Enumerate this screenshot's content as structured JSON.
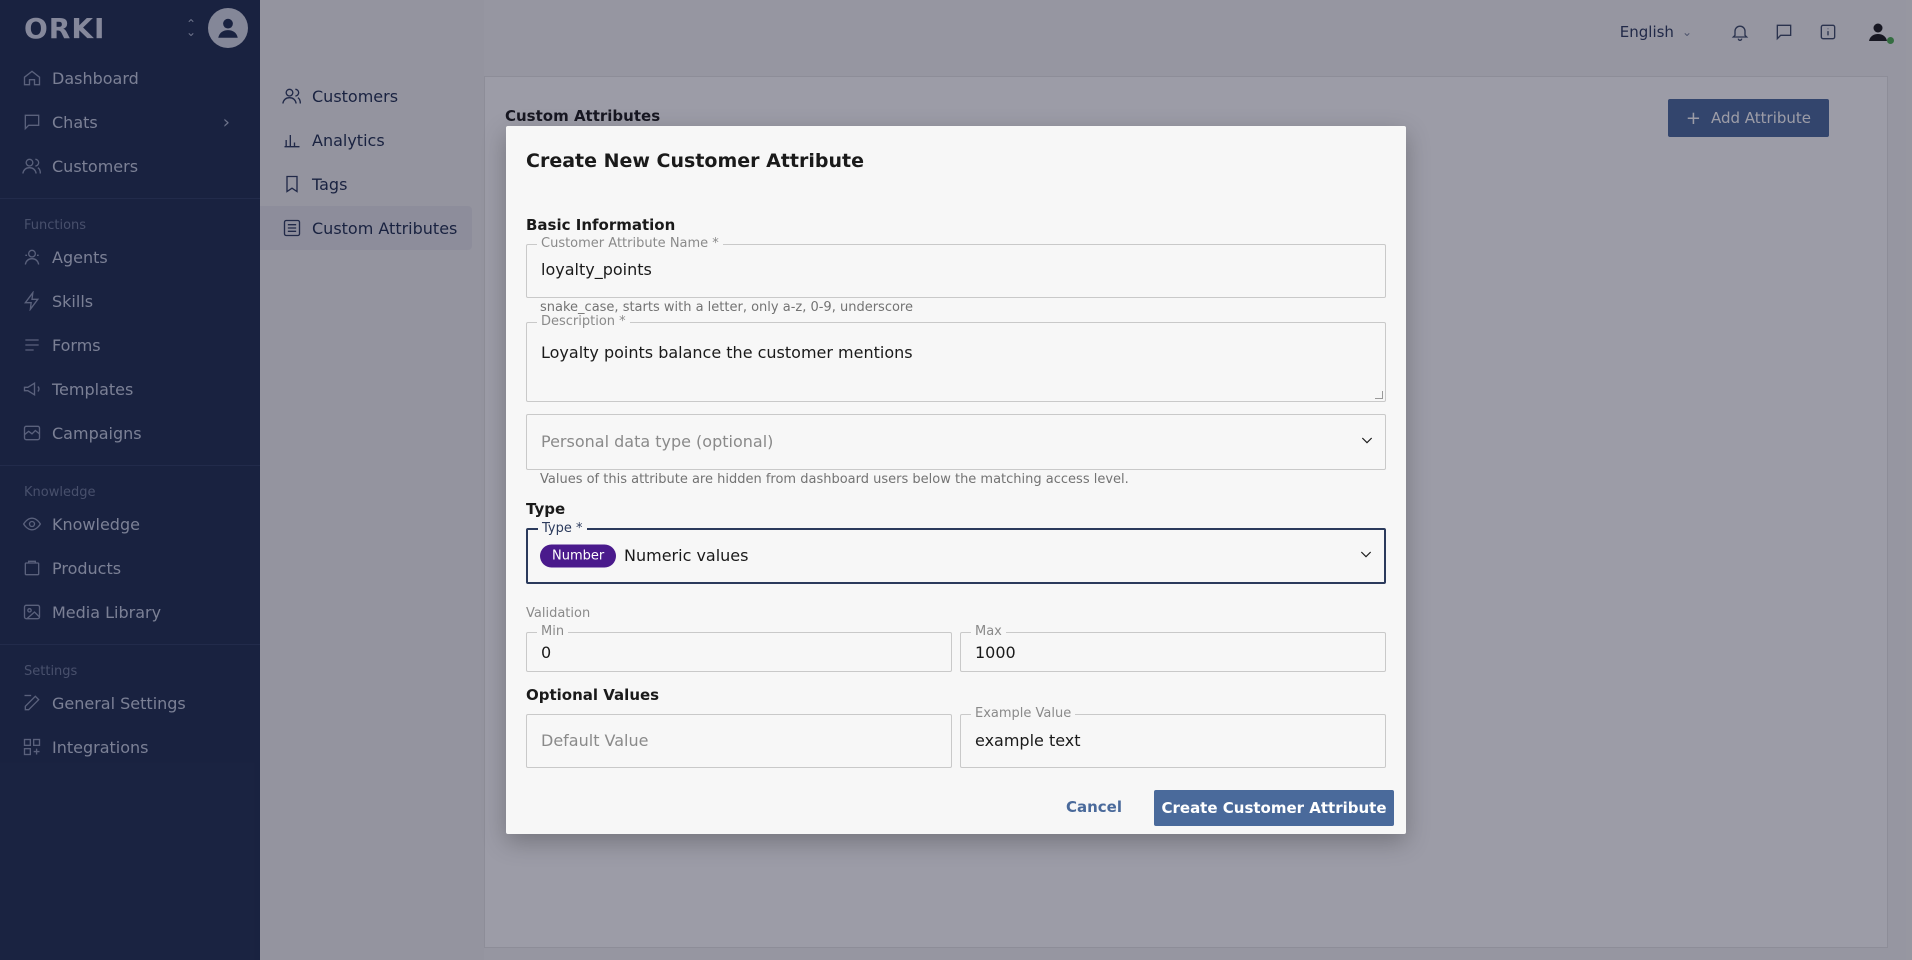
{
  "sidebar": {
    "logo": "ORKI",
    "items_top": [
      {
        "label": "Dashboard",
        "icon": "home-icon"
      },
      {
        "label": "Chats",
        "icon": "chat-icon"
      },
      {
        "label": "Customers",
        "icon": "users-icon"
      }
    ],
    "section_functions": "Functions",
    "items_functions": [
      {
        "label": "Agents",
        "icon": "agent-icon"
      },
      {
        "label": "Skills",
        "icon": "bolt-icon"
      },
      {
        "label": "Forms",
        "icon": "form-icon"
      },
      {
        "label": "Templates",
        "icon": "megaphone-icon"
      },
      {
        "label": "Campaigns",
        "icon": "campaign-icon"
      }
    ],
    "section_knowledge": "Knowledge",
    "items_knowledge": [
      {
        "label": "Knowledge",
        "icon": "eye-icon"
      },
      {
        "label": "Products",
        "icon": "box-icon"
      },
      {
        "label": "Media Library",
        "icon": "image-icon"
      }
    ],
    "section_settings": "Settings",
    "items_settings": [
      {
        "label": "General Settings",
        "icon": "edit-icon"
      },
      {
        "label": "Integrations",
        "icon": "grid-icon"
      }
    ]
  },
  "subnav": {
    "items": [
      {
        "label": "Customers"
      },
      {
        "label": "Analytics"
      },
      {
        "label": "Tags"
      },
      {
        "label": "Custom Attributes"
      }
    ]
  },
  "topbar": {
    "language": "English"
  },
  "main": {
    "title": "Custom Attributes",
    "add_button": "Add Attribute"
  },
  "modal": {
    "title": "Create New Customer Attribute",
    "basic_info": "Basic Information",
    "name_label": "Customer Attribute Name *",
    "name_value": "loyalty_points",
    "name_helper": "snake_case, starts with a letter, only a-z, 0-9, underscore",
    "desc_label": "Description *",
    "desc_value": "Loyalty points balance the customer mentions",
    "pd_placeholder": "Personal data type (optional)",
    "pd_helper": "Values of this attribute are hidden from dashboard users below the matching access level.",
    "type_section": "Type",
    "type_label": "Type *",
    "type_badge": "Number",
    "type_value": "Numeric values",
    "validation_label": "Validation",
    "min_label": "Min",
    "min_value": "0",
    "max_label": "Max",
    "max_value": "1000",
    "optional_section": "Optional Values",
    "default_placeholder": "Default Value",
    "example_label": "Example Value",
    "example_value": "example text",
    "cancel": "Cancel",
    "create": "Create Customer Attribute"
  }
}
